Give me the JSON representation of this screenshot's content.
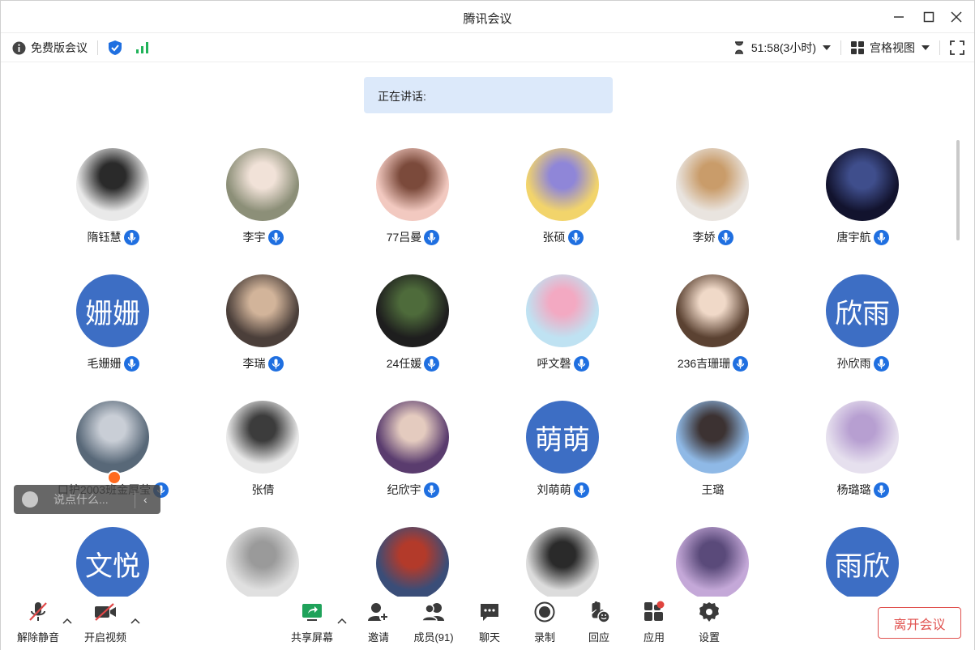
{
  "window": {
    "title": "腾讯会议"
  },
  "infobar": {
    "edition": "免费版会议",
    "timer": "51:58(3小时)",
    "view_mode": "宫格视图"
  },
  "speaking": {
    "label": "正在讲话:"
  },
  "participants": [
    {
      "name": "隋钰慧",
      "avatar": "photo",
      "colors": [
        "#e9e9e9",
        "#2a2a2a"
      ]
    },
    {
      "name": "李宇",
      "avatar": "photo",
      "colors": [
        "#8c8f78",
        "#f1e2d8"
      ]
    },
    {
      "name": "77吕曼",
      "avatar": "photo",
      "colors": [
        "#f2c9c0",
        "#7b4a3b"
      ]
    },
    {
      "name": "张硕",
      "avatar": "photo",
      "colors": [
        "#f2d46b",
        "#8f86d8"
      ]
    },
    {
      "name": "李娇",
      "avatar": "photo",
      "colors": [
        "#e9e4df",
        "#c99c6a"
      ]
    },
    {
      "name": "唐宇航",
      "avatar": "photo",
      "colors": [
        "#12132e",
        "#3f4e8c"
      ]
    },
    {
      "name": "毛姗姗",
      "avatar": "text",
      "text": "姗姗"
    },
    {
      "name": "李瑞",
      "avatar": "photo",
      "colors": [
        "#4b3f3a",
        "#d2b49a"
      ]
    },
    {
      "name": "24任媛",
      "avatar": "photo",
      "colors": [
        "#1e1e1e",
        "#4e6b3b"
      ]
    },
    {
      "name": "呼文磬",
      "avatar": "photo",
      "colors": [
        "#bfe2f2",
        "#f3a9c2"
      ]
    },
    {
      "name": "236吉珊珊",
      "avatar": "photo",
      "colors": [
        "#5b4232",
        "#f0d9c8"
      ]
    },
    {
      "name": "孙欣雨",
      "avatar": "text",
      "text": "欣雨"
    },
    {
      "name": "口护2003班金厚莹",
      "avatar": "photo",
      "colors": [
        "#586878",
        "#c9ced6"
      ],
      "host": true
    },
    {
      "name": "张倩",
      "avatar": "photo",
      "colors": [
        "#e8e8e8",
        "#3c3c3c"
      ],
      "no_mic": true
    },
    {
      "name": "纪欣宇",
      "avatar": "photo",
      "colors": [
        "#5a3c6e",
        "#e4cbbf"
      ]
    },
    {
      "name": "刘萌萌",
      "avatar": "text",
      "text": "萌萌"
    },
    {
      "name": "王璐",
      "avatar": "photo",
      "colors": [
        "#8fb9e6",
        "#3c3232"
      ],
      "no_mic": true
    },
    {
      "name": "杨璐璐",
      "avatar": "photo",
      "colors": [
        "#e6e0ee",
        "#b79fd1"
      ]
    },
    {
      "name": "",
      "avatar": "text",
      "text": "文悦"
    },
    {
      "name": "",
      "avatar": "photo",
      "colors": [
        "#e0e0e0",
        "#9a9a9a"
      ]
    },
    {
      "name": "",
      "avatar": "photo",
      "colors": [
        "#3a4d78",
        "#b33a2a"
      ]
    },
    {
      "name": "",
      "avatar": "photo",
      "colors": [
        "#dcdcdc",
        "#2a2a2a"
      ]
    },
    {
      "name": "",
      "avatar": "photo",
      "colors": [
        "#c4a8d8",
        "#5a4a7a"
      ]
    },
    {
      "name": "",
      "avatar": "text",
      "text": "雨欣"
    }
  ],
  "chat": {
    "placeholder": "说点什么...",
    "collapse": "‹"
  },
  "toolbar": {
    "unmute": "解除静音",
    "start_video": "开启视频",
    "share_screen": "共享屏幕",
    "invite": "邀请",
    "members": "成员(91)",
    "chat": "聊天",
    "record": "录制",
    "reactions": "回应",
    "apps": "应用",
    "settings": "设置",
    "leave": "离开会议"
  },
  "colors": {
    "accent": "#1f6fe0",
    "avatar_text_bg": "#3d6ec4",
    "leave": "#e0514e",
    "speaking_bg": "#dce9fa"
  }
}
